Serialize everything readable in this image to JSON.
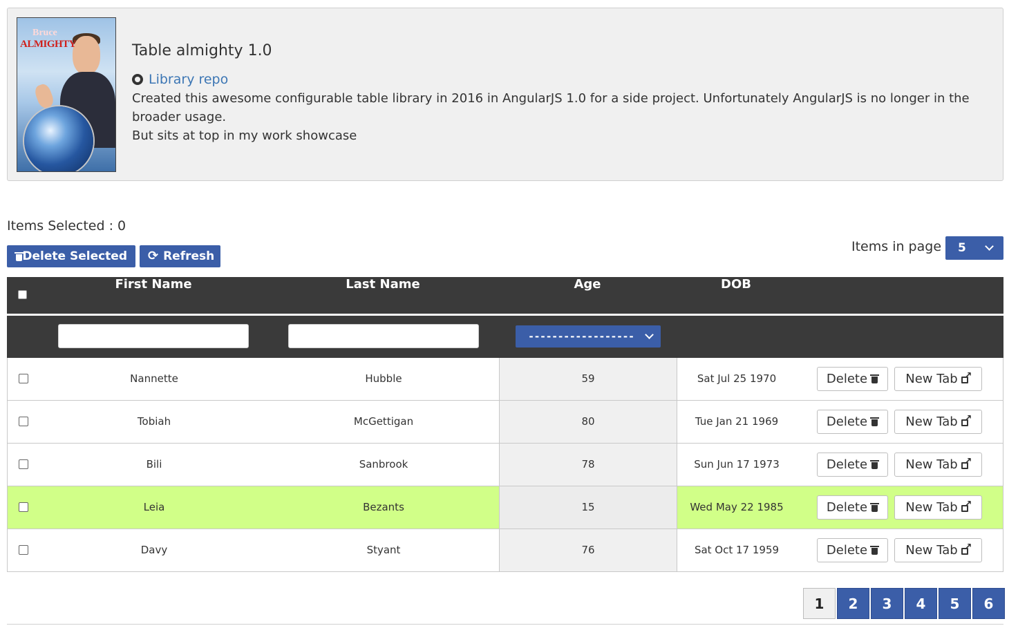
{
  "card": {
    "title": "Table almighty 1.0",
    "repo_label": "Library repo",
    "description_1": "Created this awesome configurable table library in 2016 in AngularJS 1.0 for a side project. Unfortunately AngularJS is no longer in the broader usage.",
    "description_2": "But sits at top in my work showcase",
    "poster": {
      "line1": "Bruce",
      "line2": "ALMIGHTY"
    },
    "icons": {
      "repo": "github-icon"
    }
  },
  "toolbar": {
    "items_selected": "Items Selected : 0",
    "delete_selected": "Delete Selected",
    "refresh": "Refresh",
    "items_in_page_label": "Items in page",
    "items_in_page_value": "5",
    "icons": {
      "delete": "trash-icon",
      "refresh": "refresh-icon",
      "dropdown": "chevron-down-icon"
    }
  },
  "table": {
    "columns": {
      "first": "First Name",
      "last": "Last Name",
      "age": "Age",
      "dob": "DOB"
    },
    "filters": {
      "first": "",
      "last": "",
      "age": "------------------"
    },
    "rows": [
      {
        "first": "Nannette",
        "last": "Hubble",
        "age": "59",
        "dob": "Sat Jul 25 1970",
        "highlight": false
      },
      {
        "first": "Tobiah",
        "last": "McGettigan",
        "age": "80",
        "dob": "Tue Jan 21 1969",
        "highlight": false
      },
      {
        "first": "Bili",
        "last": "Sanbrook",
        "age": "78",
        "dob": "Sun Jun 17 1973",
        "highlight": false
      },
      {
        "first": "Leia",
        "last": "Bezants",
        "age": "15",
        "dob": "Wed May 22 1985",
        "highlight": true
      },
      {
        "first": "Davy",
        "last": "Styant",
        "age": "76",
        "dob": "Sat Oct 17 1959",
        "highlight": false
      }
    ],
    "row_actions": {
      "delete": "Delete",
      "new_tab": "New Tab"
    },
    "icons": {
      "delete": "trash-icon",
      "new_tab": "external-link-icon"
    }
  },
  "pagination": {
    "pages": [
      "1",
      "2",
      "3",
      "4",
      "5",
      "6"
    ],
    "current": "1"
  },
  "colors": {
    "accent": "#3b5ea8",
    "header_bg": "#3a3a3a",
    "highlight_row": "#d1ff88",
    "card_bg": "#f0f0f0",
    "link": "#3c76b4"
  }
}
